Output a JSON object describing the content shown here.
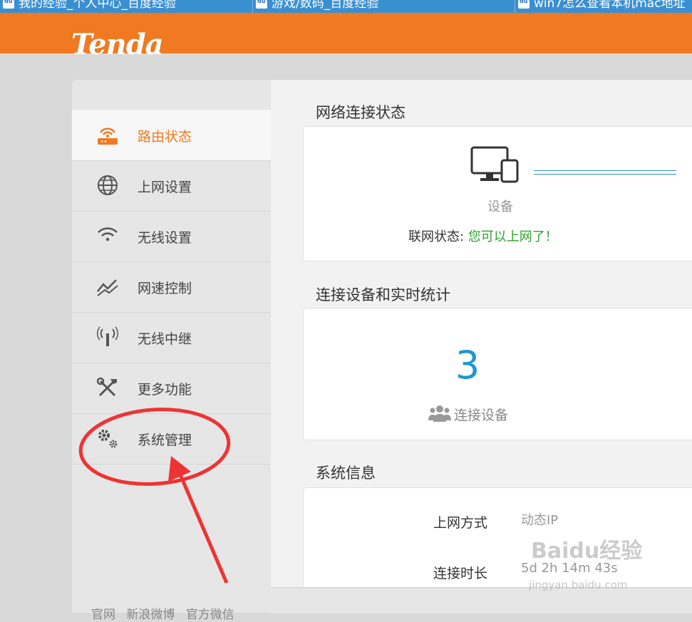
{
  "browser_tabs": [
    {
      "title": "我的经验_个人中心_百度经验"
    },
    {
      "title": "游戏/数码_百度经验"
    },
    {
      "title": "win7怎么查看本机mac地址"
    }
  ],
  "header": {
    "logo": "Tenda",
    "brand_color": "#f07921"
  },
  "sidebar": {
    "items": [
      {
        "label": "路由状态",
        "icon": "router-icon",
        "active": true
      },
      {
        "label": "上网设置",
        "icon": "globe-icon",
        "active": false
      },
      {
        "label": "无线设置",
        "icon": "wifi-icon",
        "active": false
      },
      {
        "label": "网速控制",
        "icon": "speed-chart-icon",
        "active": false
      },
      {
        "label": "无线中继",
        "icon": "antenna-icon",
        "active": false
      },
      {
        "label": "更多功能",
        "icon": "tools-icon",
        "active": false
      },
      {
        "label": "系统管理",
        "icon": "gears-icon",
        "active": false
      }
    ],
    "footer_links": [
      "官网",
      "新浪微博",
      "官方微信"
    ]
  },
  "main": {
    "network_status": {
      "title": "网络连接状态",
      "device_label": "设备",
      "status_prefix": "联网状态: ",
      "status_value": "您可以上网了！"
    },
    "connected_devices": {
      "title": "连接设备和实时统计",
      "count": "3",
      "label": "连接设备"
    },
    "system_info": {
      "title": "系统信息",
      "rows": [
        {
          "label": "上网方式",
          "value": "动态IP"
        },
        {
          "label": "连接时长",
          "value": "5d 2h 14m 43s"
        }
      ]
    }
  },
  "watermark": {
    "text": "Baidu经验",
    "url": "jingyan.baidu.com"
  },
  "colors": {
    "accent": "#f07921",
    "ok": "#2ea12e",
    "count": "#1e96d6",
    "annotation": "#ee3333"
  }
}
